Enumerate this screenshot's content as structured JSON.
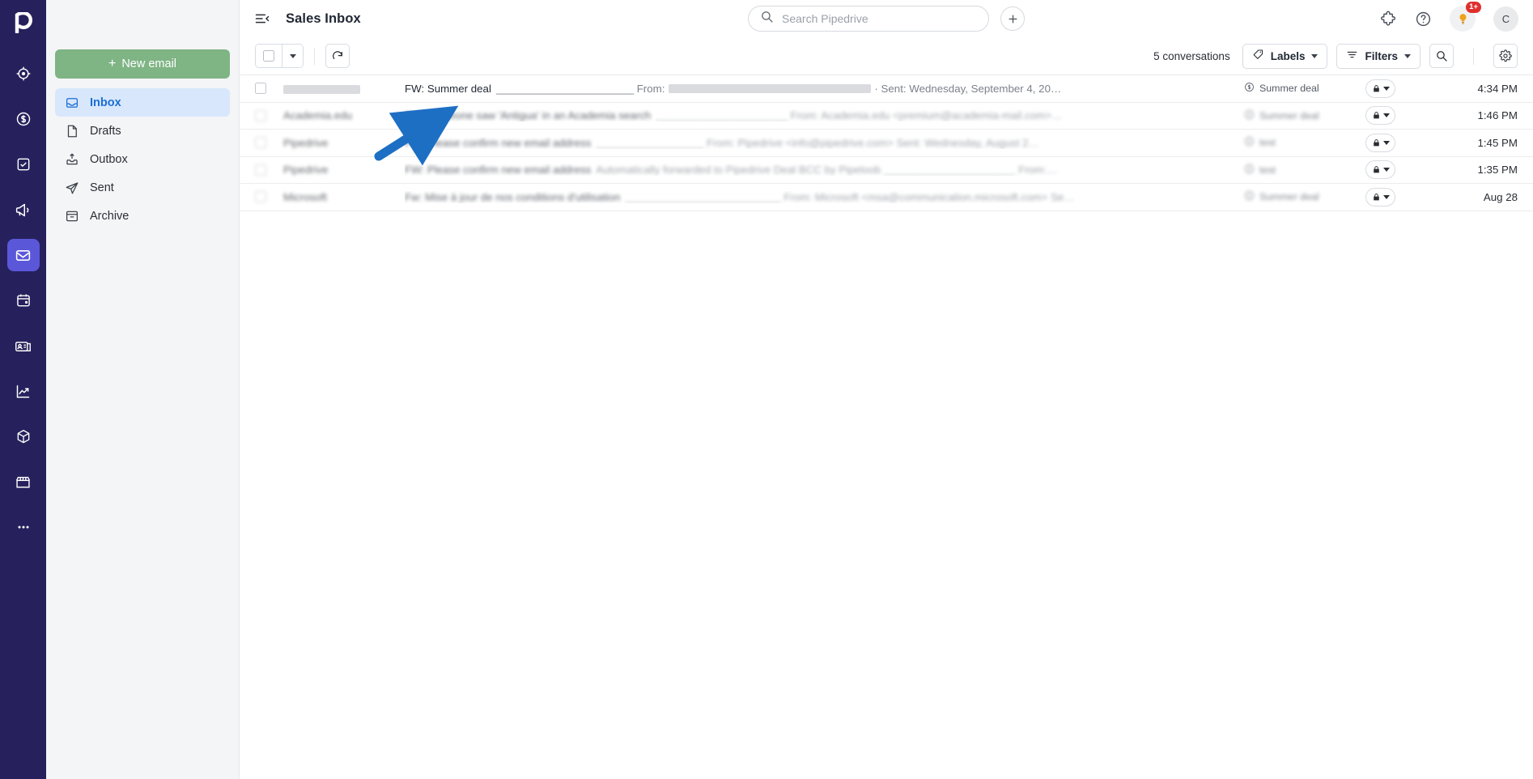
{
  "app": {
    "logo": "pipedrive-logo",
    "page_title": "Sales Inbox"
  },
  "topbar": {
    "menu_icon": "hamburger-collapse-icon",
    "search": {
      "icon": "search-icon",
      "value": "",
      "placeholder": "Search Pipedrive"
    },
    "add_button": {
      "icon": "plus-icon",
      "label": "+"
    },
    "right_icons": [
      {
        "name": "extensions-icon",
        "label": ""
      },
      {
        "name": "help-icon",
        "label": "?"
      }
    ],
    "notifications": {
      "icon": "lightbulb-icon",
      "badge": "1+"
    },
    "avatar": {
      "initial": "C"
    }
  },
  "rail": {
    "items": [
      {
        "name": "leads-icon",
        "active": false
      },
      {
        "name": "deals-icon",
        "active": false
      },
      {
        "name": "activities-icon",
        "active": false
      },
      {
        "name": "campaigns-icon",
        "active": false
      },
      {
        "name": "mail-icon",
        "active": true
      },
      {
        "name": "calendar-icon",
        "active": false
      },
      {
        "name": "contacts-icon",
        "active": false
      },
      {
        "name": "insights-icon",
        "active": false
      },
      {
        "name": "products-icon",
        "active": false
      },
      {
        "name": "marketplace-icon",
        "active": false
      },
      {
        "name": "more-icon",
        "active": false
      }
    ]
  },
  "sidebar": {
    "new_email_label": "New email",
    "folders": [
      {
        "label": "Inbox",
        "icon": "inbox-icon",
        "active": true
      },
      {
        "label": "Drafts",
        "icon": "drafts-icon",
        "active": false
      },
      {
        "label": "Outbox",
        "icon": "outbox-icon",
        "active": false
      },
      {
        "label": "Sent",
        "icon": "sent-icon",
        "active": false
      },
      {
        "label": "Archive",
        "icon": "archive-icon",
        "active": false
      }
    ]
  },
  "toolbar": {
    "select_all": {
      "icon": "checkbox-icon"
    },
    "select_dropdown": {
      "icon": "chevron-down-icon"
    },
    "refresh": {
      "icon": "refresh-icon"
    },
    "conversation_count": "5 conversations",
    "labels_button": {
      "label": "Labels",
      "icon": "tag-icon",
      "chevron": "chevron-down-icon"
    },
    "filters_button": {
      "label": "Filters",
      "icon": "filter-icon",
      "chevron": "chevron-down-icon"
    },
    "search_button": {
      "icon": "search-icon"
    },
    "settings_button": {
      "icon": "gear-icon"
    }
  },
  "list": {
    "rows": [
      {
        "sender": "",
        "sender_redacted": true,
        "subject": "FW: Summer deal",
        "snippet": "_______________________ From:",
        "snippet_tail": "· Sent: Wednesday, September 4, 20…",
        "deal": "Summer deal",
        "deal_icon": "deal-money-icon",
        "lock_icon": "lock-icon",
        "time": "4:34 PM",
        "blurred": false
      },
      {
        "sender": "Academia.edu",
        "sender_redacted": false,
        "subject": "FW: Someone saw 'Antigua' in an Academia search",
        "snippet": "______________________ From: Academia.edu <premium@academia-mail.com>…",
        "snippet_tail": "",
        "deal": "Summer deal",
        "deal_icon": "deal-money-icon",
        "lock_icon": "lock-icon",
        "time": "1:46 PM",
        "blurred": true
      },
      {
        "sender": "Pipedrive",
        "sender_redacted": false,
        "subject": "FW: Please confirm new email address",
        "snippet": "__________________ From: Pipedrive <info@pipedrive.com> Sent: Wednesday, August 2…",
        "snippet_tail": "",
        "deal": "test",
        "deal_icon": "deal-money-icon",
        "lock_icon": "lock-icon",
        "time": "1:45 PM",
        "blurred": true
      },
      {
        "sender": "Pipedrive",
        "sender_redacted": false,
        "subject": "FW: Please confirm new email address",
        "snippet": "Automatically forwarded to Pipedrive Deal BCC by Pipeloob ______________________ From:…",
        "snippet_tail": "",
        "deal": "test",
        "deal_icon": "deal-money-icon",
        "lock_icon": "lock-icon",
        "time": "1:35 PM",
        "blurred": true
      },
      {
        "sender": "Microsoft",
        "sender_redacted": false,
        "subject": "Fw: Mise à jour de nos conditions d'utilisation",
        "snippet": "__________________________ From: Microsoft <msa@communication.microsoft.com> Se…",
        "snippet_tail": "",
        "deal": "Summer deal",
        "deal_icon": "deal-money-icon",
        "lock_icon": "lock-icon",
        "time": "Aug 28",
        "blurred": true
      }
    ]
  },
  "annotation": {
    "arrow_color": "#1d6fc4",
    "name": "pointer-arrow"
  },
  "colors": {
    "rail_bg": "#26215c",
    "rail_active": "#5b57d9",
    "sidebar_bg": "#f4f5f7",
    "new_email_green": "#7fb484",
    "folder_active_bg": "#d8e7fc",
    "folder_active_text": "#1a6fd4",
    "badge_red": "#e02e2e"
  }
}
